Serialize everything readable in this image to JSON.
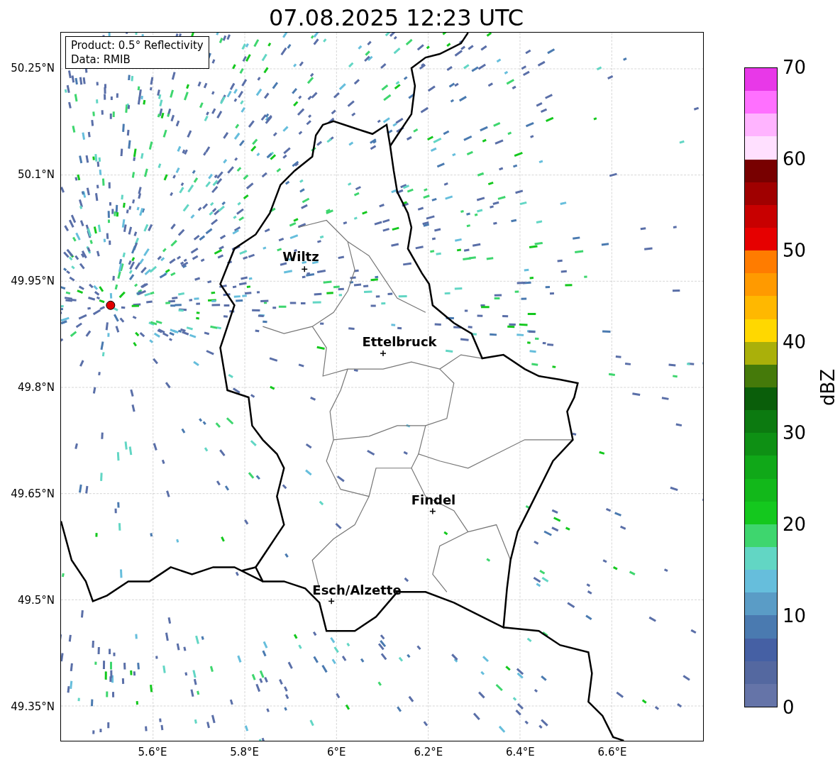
{
  "title": "07.08.2025 12:23 UTC",
  "info_box": [
    "Product: 0.5° Reflectivity",
    "Data: RMIB"
  ],
  "y_ticks": [
    "50.25°N",
    "50.1°N",
    "49.95°N",
    "49.8°N",
    "49.65°N",
    "49.5°N",
    "49.35°N"
  ],
  "x_ticks": [
    "5.6°E",
    "5.8°E",
    "6°E",
    "6.2°E",
    "6.4°E",
    "6.6°E"
  ],
  "cities": [
    {
      "name": "Wiltz"
    },
    {
      "name": "Ettelbruck"
    },
    {
      "name": "Findel"
    },
    {
      "name": "Esch/Alzette"
    }
  ],
  "colorbar": {
    "label": "dBZ",
    "ticks": [
      "70",
      "60",
      "50",
      "40",
      "30",
      "20",
      "10",
      "0"
    ],
    "bins": [
      {
        "color": "#e838e8"
      },
      {
        "color": "#ff70ff"
      },
      {
        "color": "#ffb4ff"
      },
      {
        "color": "#ffe0ff"
      },
      {
        "color": "#780000"
      },
      {
        "color": "#a00000"
      },
      {
        "color": "#c80000"
      },
      {
        "color": "#e60000"
      },
      {
        "color": "#ff7c00"
      },
      {
        "color": "#ff9a00"
      },
      {
        "color": "#ffb800"
      },
      {
        "color": "#ffd800"
      },
      {
        "color": "#aab00a"
      },
      {
        "color": "#457a0a"
      },
      {
        "color": "#0a5e0a"
      },
      {
        "color": "#0c7a10"
      },
      {
        "color": "#0e9014"
      },
      {
        "color": "#10a818"
      },
      {
        "color": "#12b81a"
      },
      {
        "color": "#14c81e"
      },
      {
        "color": "#3ed66e"
      },
      {
        "color": "#62d6c4"
      },
      {
        "color": "#66bedc"
      },
      {
        "color": "#5a9cc6"
      },
      {
        "color": "#4a7ab0"
      },
      {
        "color": "#4560a4"
      },
      {
        "color": "#5468a0"
      },
      {
        "color": "#6574a8"
      }
    ]
  }
}
